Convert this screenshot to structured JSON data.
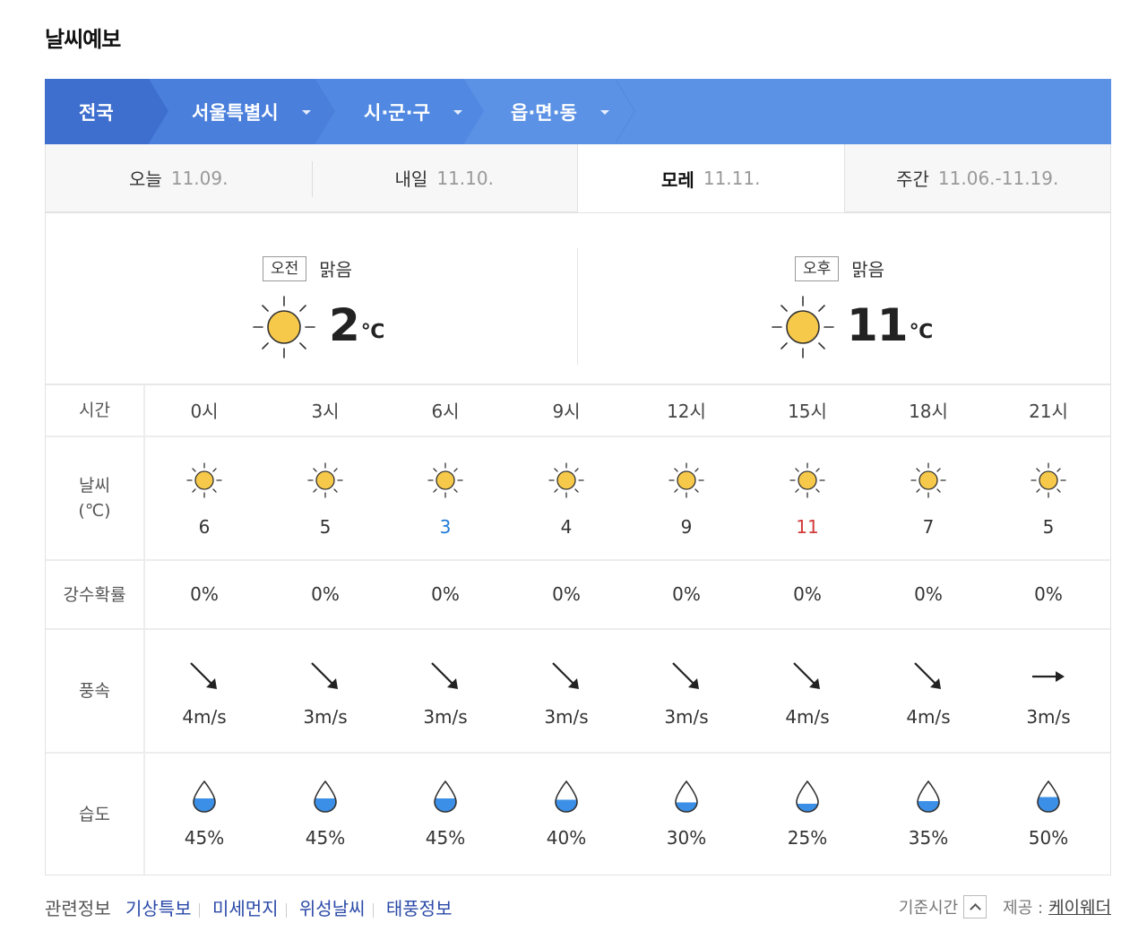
{
  "page_title": "날씨예보",
  "breadcrumb": {
    "items": [
      {
        "label": "전국"
      },
      {
        "label": "서울특별시"
      },
      {
        "label": "시·군·구"
      },
      {
        "label": "읍·면·동"
      }
    ]
  },
  "tabs": [
    {
      "label": "오늘",
      "date": "11.09."
    },
    {
      "label": "내일",
      "date": "11.10."
    },
    {
      "label": "모레",
      "date": "11.11."
    },
    {
      "label": "주간",
      "date": "11.06.-11.19."
    }
  ],
  "summary": {
    "am": {
      "badge": "오전",
      "condition": "맑음",
      "temp": "2",
      "unit": "℃",
      "icon": "sun-icon"
    },
    "pm": {
      "badge": "오후",
      "condition": "맑음",
      "temp": "11",
      "unit": "℃",
      "icon": "sun-icon"
    }
  },
  "table": {
    "headers": {
      "time": "시간",
      "weather": "날씨",
      "weather_unit": "(℃)",
      "rain": "강수확률",
      "wind": "풍속",
      "humidity": "습도"
    },
    "hours": [
      "0시",
      "3시",
      "6시",
      "9시",
      "12시",
      "15시",
      "18시",
      "21시"
    ],
    "temps": [
      "6",
      "5",
      "3",
      "4",
      "9",
      "11",
      "7",
      "5"
    ],
    "temp_colors": [
      "#333333",
      "#333333",
      "#1f7bd8",
      "#333333",
      "#333333",
      "#d23a3a",
      "#333333",
      "#333333"
    ],
    "rain": [
      "0%",
      "0%",
      "0%",
      "0%",
      "0%",
      "0%",
      "0%",
      "0%"
    ],
    "wind_speed": [
      "4m/s",
      "3m/s",
      "3m/s",
      "3m/s",
      "3m/s",
      "4m/s",
      "4m/s",
      "3m/s"
    ],
    "wind_dir": [
      "southeast-arrow-icon",
      "southeast-arrow-icon",
      "southeast-arrow-icon",
      "southeast-arrow-icon",
      "southeast-arrow-icon",
      "southeast-arrow-icon",
      "southeast-arrow-icon",
      "east-arrow-icon"
    ],
    "humidity": [
      "45%",
      "45%",
      "45%",
      "40%",
      "30%",
      "25%",
      "35%",
      "50%"
    ],
    "humidity_fraction": [
      0.45,
      0.45,
      0.45,
      0.4,
      0.3,
      0.25,
      0.35,
      0.5
    ]
  },
  "footer": {
    "related_label": "관련정보",
    "links": [
      "기상특보",
      "미세먼지",
      "위성날씨",
      "태풍정보"
    ],
    "base_time_label": "기준시간",
    "provider_label": "제공 :",
    "provider": "케이웨더"
  },
  "colors": {
    "sun_fill": "#f7c94a",
    "drop_fill": "#3b8fe6",
    "breadcrumb": "#5b92e5"
  }
}
